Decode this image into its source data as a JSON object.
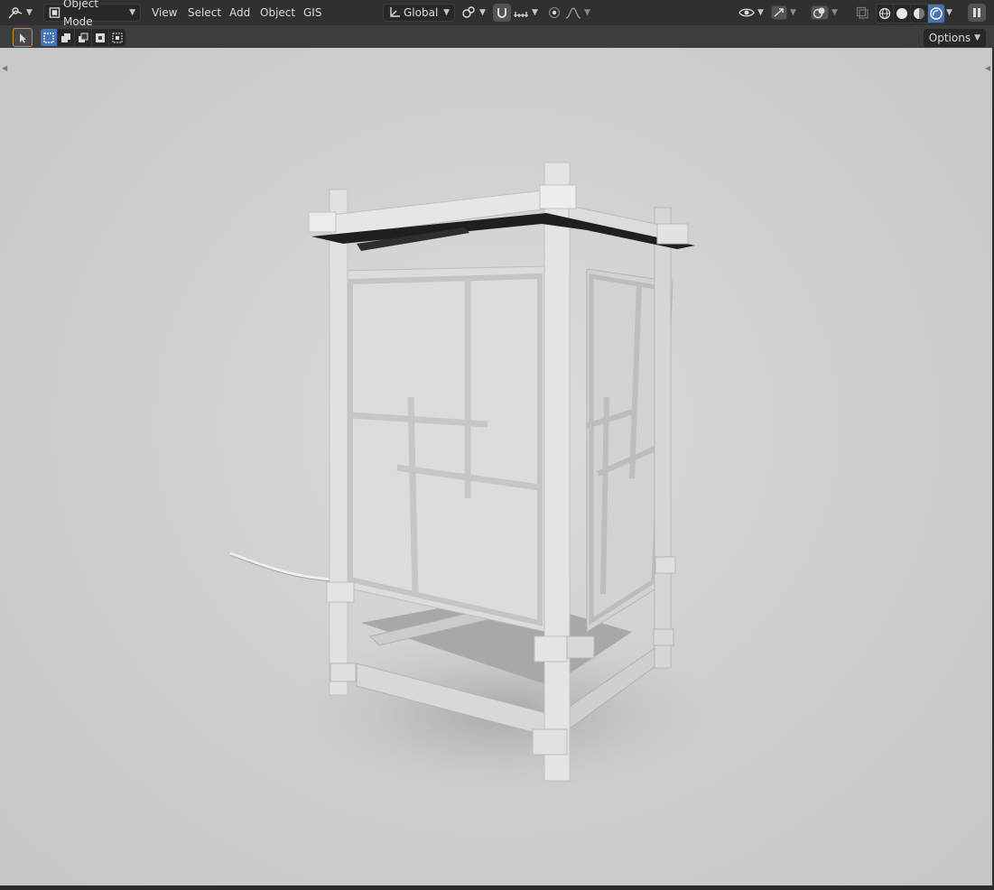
{
  "header": {
    "mode_label": "Object Mode",
    "menus": [
      "View",
      "Select",
      "Add",
      "Object",
      "GIS"
    ],
    "orientation_label": "Global"
  },
  "tool_header": {
    "options_label": "Options"
  },
  "colors": {
    "accent": "#4772b3",
    "header_bg": "#303030",
    "viewport_bg": "#d0d0d0"
  },
  "icons": {
    "editor_type": "viewport-editor-icon",
    "mode": "object-mode-icon",
    "transform": "transform-pivot-icon",
    "snap": "magnet-icon",
    "proportional": "proportional-edit-icon",
    "visibility": "eye-icon",
    "gizmo": "gizmo-icon",
    "overlays": "overlay-icon",
    "xray": "xray-icon",
    "shading": [
      "wireframe-icon",
      "solid-icon",
      "material-icon",
      "rendered-icon"
    ]
  }
}
